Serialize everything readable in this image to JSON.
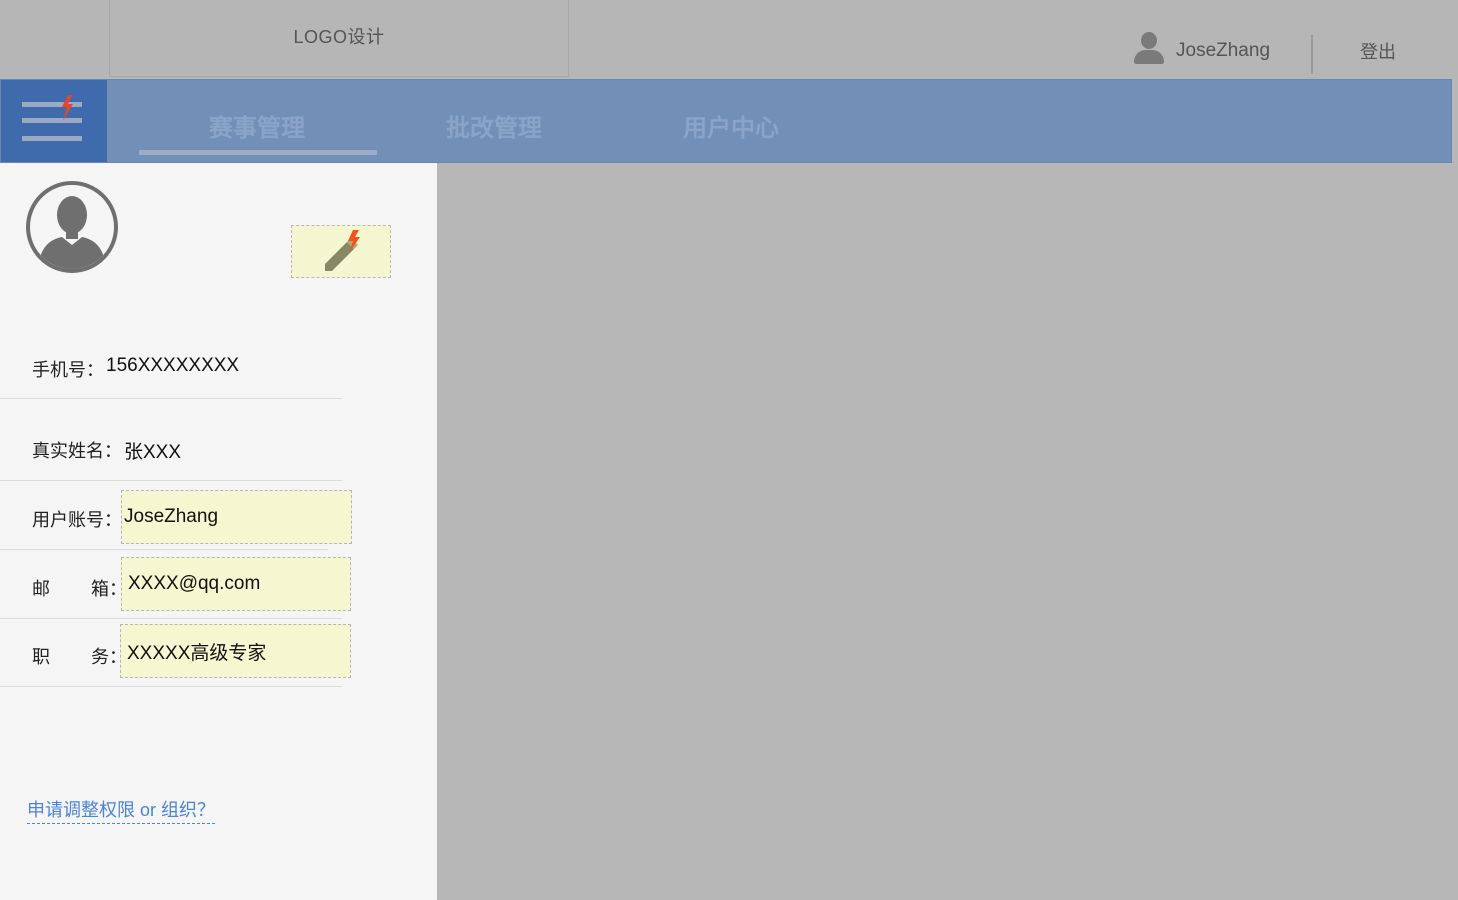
{
  "header": {
    "logo": "LOGO设计",
    "user_name": "JoseZhang",
    "logout": "登出",
    "icons": {
      "user": "user-silhouette-icon",
      "menu": "hamburger-menu-icon"
    }
  },
  "nav": {
    "tabs": [
      {
        "label": "赛事管理",
        "active": true
      },
      {
        "label": "批改管理",
        "active": false
      },
      {
        "label": "用户中心",
        "active": false
      }
    ]
  },
  "profile": {
    "avatar_icon": "avatar-silhouette-icon",
    "edit_icon": "pencil-edit-icon",
    "phone": {
      "label": "手机号：",
      "value": "156XXXXXXXX"
    },
    "real_name": {
      "label": "真实姓名：",
      "value": "张XXX"
    },
    "account": {
      "label": "用户账号：",
      "value": "JoseZhang"
    },
    "email": {
      "label_a": "邮",
      "label_b": "箱：",
      "value": "XXXX@qq.com"
    },
    "position": {
      "label_a": "职",
      "label_b": "务：",
      "value": "XXXXX高级专家"
    },
    "request_link": "申请调整权限 or 组织？"
  },
  "colors": {
    "navbar": "#718fb7",
    "menu_button": "#3f6aab",
    "field_bg": "#f5f7d0",
    "link": "#4a84d6",
    "panel_bg": "#f5f5f5",
    "page_bg": "#b7b7b7"
  }
}
